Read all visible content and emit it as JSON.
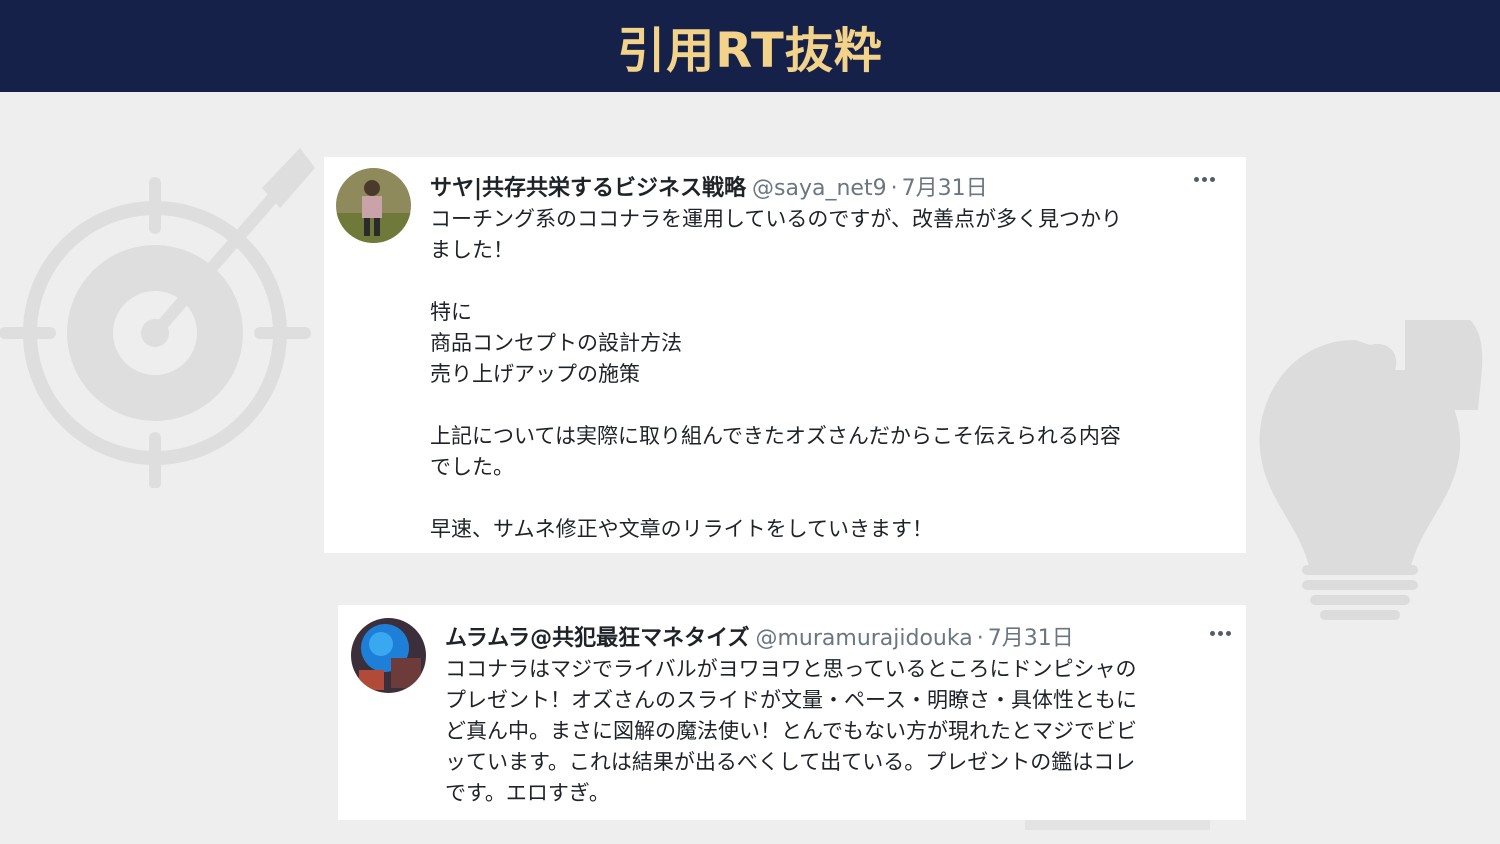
{
  "header": {
    "title": "引用RT抜粋"
  },
  "tweets": [
    {
      "display_name": "サヤ|共存共栄するビジネス戦略",
      "handle": "@saya_net9",
      "separator": "·",
      "date": "7月31日",
      "avatar_icon": "user-avatar-icon",
      "more_icon": "more-options-icon",
      "lines": {
        "l1": "コーチング系のココナラを運用しているのですが、改善点が多く見つかり",
        "l2": "ました！",
        "l3": "特に",
        "l4": "商品コンセプトの設計方法",
        "l5": "売り上げアップの施策",
        "l6": "上記については実際に取り組んできたオズさんだからこそ伝えられる内容",
        "l7": "でした。",
        "l8": "早速、サムネ修正や文章のリライトをしていきます！"
      }
    },
    {
      "display_name": "ムラムラ@共犯最狂マネタイズ",
      "handle": "@muramurajidouka",
      "separator": "·",
      "date": "7月31日",
      "avatar_icon": "user-avatar-icon",
      "more_icon": "more-options-icon",
      "lines": {
        "l1": "ココナラはマジでライバルがヨワヨワと思っているところにドンピシャの",
        "l2": "プレゼント！オズさんのスライドが文量・ペース・明瞭さ・具体性ともに",
        "l3": "ど真ん中。まさに図解の魔法使い！とんでもない方が現れたとマジでビビ",
        "l4": "ッています。これは結果が出るべくして出ている。プレゼントの鑑はコレ",
        "l5": "です。エロすぎ。"
      }
    }
  ],
  "decorations": {
    "left_icon": "target-arrow-icon",
    "right_icon": "lightbulb-puzzle-icon"
  },
  "colors": {
    "header_bg": "#16214a",
    "header_text": "#f3d28a",
    "page_bg": "#eeeeee",
    "card_bg": "#ffffff",
    "muted": "#6b7680"
  }
}
